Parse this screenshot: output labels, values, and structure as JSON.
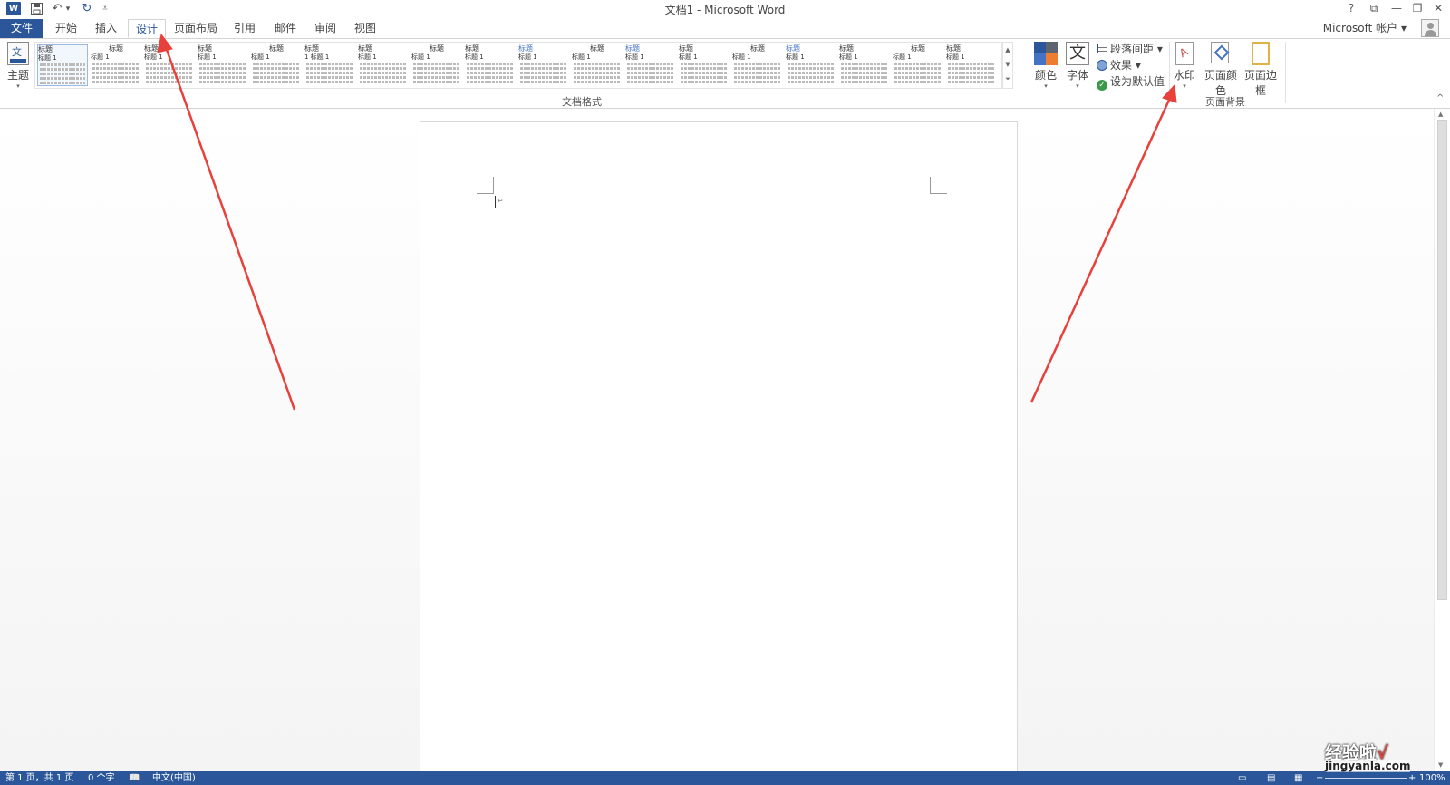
{
  "window": {
    "title": "文档1 - Microsoft Word",
    "app_icon": "W",
    "help": "?",
    "restore_ribbon": "⧉",
    "minimize": "—",
    "maximize": "❐",
    "close": "✕"
  },
  "quick_access": {
    "save_icon": "💾",
    "undo": "↶",
    "undo_drop": "▾",
    "redo": "↻",
    "customize": "⩡"
  },
  "tabs": [
    {
      "label": "文件"
    },
    {
      "label": "开始"
    },
    {
      "label": "插入"
    },
    {
      "label": "设计"
    },
    {
      "label": "页面布局"
    },
    {
      "label": "引用"
    },
    {
      "label": "邮件"
    },
    {
      "label": "审阅"
    },
    {
      "label": "视图"
    }
  ],
  "account": {
    "label": "Microsoft 帐户 ▾"
  },
  "ribbon": {
    "theme_label": "主题",
    "group_document_format": "文档格式",
    "style_thumbnails": [
      {
        "heading": "标题",
        "sub": "标题 1"
      },
      {
        "heading": "标题",
        "sub": "标题 1"
      },
      {
        "heading": "标题",
        "sub": "标题 1"
      },
      {
        "heading": "标题",
        "sub": "标题 1"
      },
      {
        "heading": "标题",
        "sub": "标题 1"
      },
      {
        "heading": "标题",
        "sub": "1 标题 1"
      },
      {
        "heading": "标题",
        "sub": "标题 1"
      },
      {
        "heading": "标题",
        "sub": "标题 1"
      },
      {
        "heading": "标题",
        "sub": "标题 1"
      },
      {
        "heading": "标题",
        "sub": "标题 1"
      },
      {
        "heading": "标题",
        "sub": "标题 1"
      },
      {
        "heading": "标题",
        "sub": "标题 1"
      },
      {
        "heading": "标题",
        "sub": "标题 1"
      },
      {
        "heading": "标题",
        "sub": "标题 1"
      },
      {
        "heading": "标题",
        "sub": "标题 1"
      },
      {
        "heading": "标题",
        "sub": "标题 1"
      },
      {
        "heading": "标题",
        "sub": "标题 1"
      },
      {
        "heading": "标题",
        "sub": "标题 1"
      }
    ],
    "colors_label": "颜色",
    "fonts_label": "字体",
    "fonts_glyph": "文",
    "paragraph_spacing_label": "段落间距 ▾",
    "effects_label": "效果 ▾",
    "set_default_label": "设为默认值",
    "watermark_label": "水印",
    "page_color_label": "页面颜色",
    "page_borders_label": "页面边框",
    "group_page_background": "页面背景",
    "collapse": "^"
  },
  "status": {
    "page": "第 1 页，共 1 页",
    "words": "0 个字",
    "language": "中文(中国)",
    "zoom": "100%"
  },
  "watermark_overlay": {
    "brand": "经验啦",
    "check": "√",
    "url": "jingyanla.com"
  },
  "colors": {
    "accent": "#2b579a",
    "arrow": "#e8403a"
  }
}
